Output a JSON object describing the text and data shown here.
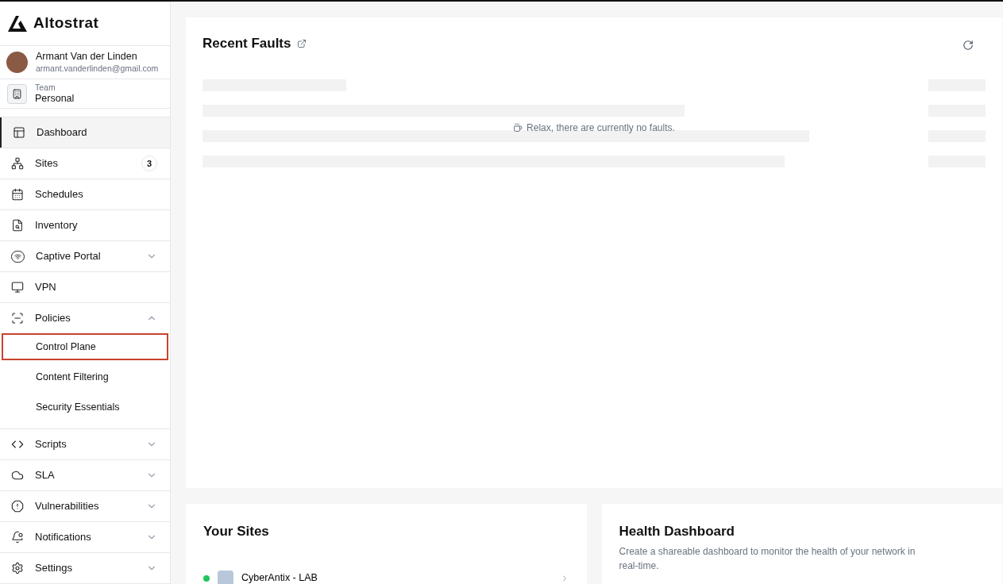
{
  "brand": {
    "name": "Altostrat"
  },
  "user": {
    "name": "Armant Van der Linden",
    "email": "armant.vanderlinden@gmail.com"
  },
  "team": {
    "label": "Team",
    "name": "Personal"
  },
  "nav": [
    {
      "label": "Dashboard",
      "selected": true
    },
    {
      "label": "Sites",
      "selected": false,
      "badge": "3"
    },
    {
      "label": "Schedules",
      "selected": false
    },
    {
      "label": "Inventory",
      "selected": false
    },
    {
      "label": "Captive Portal",
      "selected": false,
      "expanded": false
    },
    {
      "label": "VPN",
      "selected": false
    },
    {
      "label": "Policies",
      "selected": false,
      "expanded": true,
      "children": [
        {
          "label": "Control Plane",
          "highlighted": true
        },
        {
          "label": "Content Filtering",
          "highlighted": false
        },
        {
          "label": "Security Essentials",
          "highlighted": false
        }
      ]
    },
    {
      "label": "Scripts",
      "selected": false,
      "expanded": false
    },
    {
      "label": "SLA",
      "selected": false,
      "expanded": false
    },
    {
      "label": "Vulnerabilities",
      "selected": false,
      "expanded": false
    },
    {
      "label": "Notifications",
      "selected": false,
      "expanded": false
    },
    {
      "label": "Settings",
      "selected": false,
      "expanded": false
    }
  ],
  "faults": {
    "title": "Recent Faults",
    "empty_message": "Relax, there are currently no faults."
  },
  "sites": {
    "title": "Your Sites",
    "items": [
      {
        "name": "CyberAntix - LAB",
        "color": "#22c55e"
      }
    ]
  },
  "health": {
    "title": "Health Dashboard",
    "description": "Create a shareable dashboard to monitor the health of your network in real-time."
  }
}
